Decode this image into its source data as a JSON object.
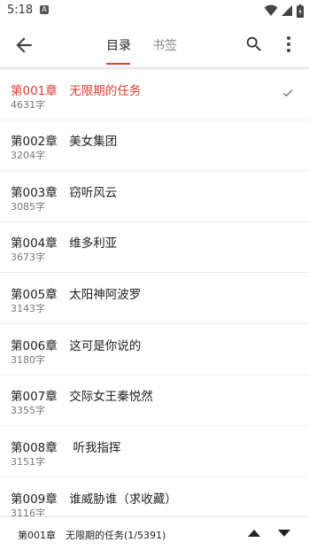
{
  "status_bar": {
    "time": "5:18",
    "notification_glyph": "A",
    "icons": [
      "wifi-icon",
      "signal-icon",
      "battery-icon"
    ]
  },
  "toolbar": {
    "back_icon": "arrow-left-icon",
    "tabs": [
      {
        "label": "目录",
        "active": true
      },
      {
        "label": "书签",
        "active": false
      }
    ],
    "search_icon": "search-icon",
    "more_icon": "more-vert-icon",
    "accent_color": "#e03c31"
  },
  "chapters": [
    {
      "title": "第001章　无限期的任务",
      "count": "4631字",
      "current": true
    },
    {
      "title": "第002章　美女集团",
      "count": "3204字",
      "current": false
    },
    {
      "title": "第003章　窃听风云",
      "count": "3085字",
      "current": false
    },
    {
      "title": "第004章　维多利亚",
      "count": "3673字",
      "current": false
    },
    {
      "title": "第005章　太阳神阿波罗",
      "count": "3143字",
      "current": false
    },
    {
      "title": "第006章　这可是你说的",
      "count": "3180字",
      "current": false
    },
    {
      "title": "第007章　交际女王秦悦然",
      "count": "3355字",
      "current": false
    },
    {
      "title": "第008章　 听我指挥",
      "count": "3151字",
      "current": false
    },
    {
      "title": "第009章　谁威胁谁（求收藏）",
      "count": "3116字",
      "current": false
    }
  ],
  "bottom_bar": {
    "current_chapter": "第001章　无限期的任务(1/5391)",
    "up_icon": "triangle-up-icon",
    "down_icon": "triangle-down-icon"
  }
}
